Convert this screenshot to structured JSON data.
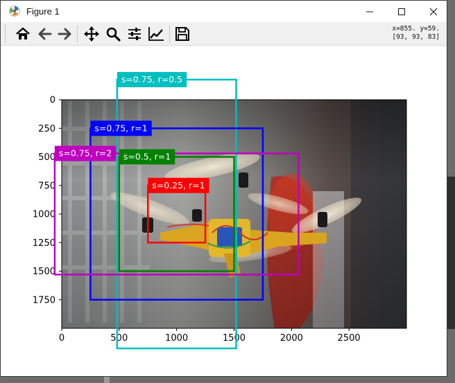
{
  "window": {
    "title": "Figure 1",
    "controls": {
      "minimize": "minimize-icon",
      "maximize": "maximize-icon",
      "close": "close-icon"
    }
  },
  "toolbar": {
    "buttons": [
      {
        "name": "home",
        "icon": "home-icon"
      },
      {
        "name": "back",
        "icon": "arrow-left-icon"
      },
      {
        "name": "forward",
        "icon": "arrow-right-icon"
      },
      {
        "name": "pan",
        "icon": "move-icon"
      },
      {
        "name": "zoom",
        "icon": "magnifier-icon"
      },
      {
        "name": "subplots",
        "icon": "sliders-icon"
      },
      {
        "name": "edit-axis",
        "icon": "line-chart-icon"
      },
      {
        "name": "save",
        "icon": "floppy-disk-icon"
      }
    ],
    "coords_line1": "x=855.  y=59.",
    "coords_line2": "[93, 93, 83]"
  },
  "chart_data": {
    "type": "image",
    "description_in_image": "drone photograph with anchor boxes",
    "xlim": [
      0,
      3000
    ],
    "ylim": [
      2000,
      0
    ],
    "xticks": [
      0,
      500,
      1000,
      1500,
      2000,
      2500
    ],
    "yticks": [
      0,
      250,
      500,
      750,
      1000,
      1250,
      1500,
      1750
    ],
    "boxes": [
      {
        "label": "s=0.75, r=0.5",
        "color": "#00bfbf",
        "x0": 482,
        "y0": -176,
        "x1": 1518,
        "y1": 2176
      },
      {
        "label": "s=0.75, r=1",
        "color": "#0000ff",
        "x0": 250,
        "y0": 250,
        "x1": 1750,
        "y1": 1750
      },
      {
        "label": "s=0.75, r=2",
        "color": "#bf00bf",
        "x0": -61,
        "y0": 470,
        "x1": 2061,
        "y1": 1530
      },
      {
        "label": "s=0.5, r=1",
        "color": "#008000",
        "x0": 500,
        "y0": 500,
        "x1": 1500,
        "y1": 1500
      },
      {
        "label": "s=0.25, r=1",
        "color": "#ff0000",
        "x0": 750,
        "y0": 750,
        "x1": 1250,
        "y1": 1250
      }
    ]
  }
}
